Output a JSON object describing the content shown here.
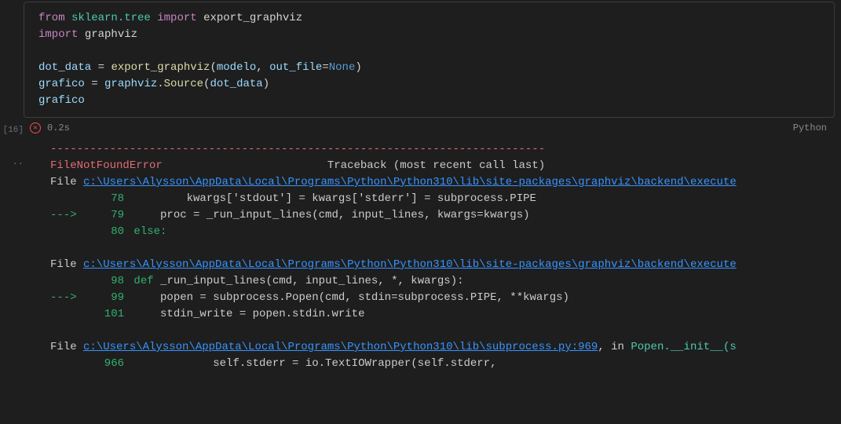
{
  "gutter": {
    "cell_label": "[16]",
    "dots": ".."
  },
  "code": {
    "l1_from": "from",
    "l1_mod": "sklearn.tree",
    "l1_import": "import",
    "l1_name": "export_graphviz",
    "l2_import": "import",
    "l2_name": "graphviz",
    "l4_var": "dot_data",
    "l4_eq": " = ",
    "l4_fn": "export_graphviz",
    "l4_open": "(",
    "l4_arg1": "modelo",
    "l4_comma": ", ",
    "l4_kwarg": "out_file",
    "l4_eqs": "=",
    "l4_none": "None",
    "l4_close": ")",
    "l5_var": "grafico",
    "l5_eq": " = ",
    "l5_mod": "graphviz",
    "l5_dot": ".",
    "l5_fn": "Source",
    "l5_open": "(",
    "l5_arg": "dot_data",
    "l5_close": ")",
    "l6": "grafico"
  },
  "status": {
    "time": "0.2s",
    "lang": "Python"
  },
  "traceback": {
    "dashes": "---------------------------------------------------------------------------",
    "error_name": "FileNotFoundError",
    "tb_label": "Traceback (most recent call last)",
    "file_word": "File ",
    "frames": [
      {
        "path": "c:\\Users\\Alysson\\AppData\\Local\\Programs\\Python\\Python310\\lib\\site-packages\\graphviz\\backend\\execute",
        "lines": [
          {
            "no": "78",
            "arrow": "     ",
            "code": "        kwargs['stdout'] = kwargs['stderr'] = subprocess.PIPE"
          },
          {
            "no": "79",
            "arrow": "---> ",
            "code": "    proc = _run_input_lines(cmd, input_lines, kwargs=kwargs)"
          },
          {
            "no": "80",
            "arrow": "     ",
            "code": "else:"
          }
        ]
      },
      {
        "path": "c:\\Users\\Alysson\\AppData\\Local\\Programs\\Python\\Python310\\lib\\site-packages\\graphviz\\backend\\execute",
        "lines": [
          {
            "no": "98",
            "arrow": "     ",
            "code": "def _run_input_lines(cmd, input_lines, *, kwargs):"
          },
          {
            "no": "99",
            "arrow": "---> ",
            "code": "    popen = subprocess.Popen(cmd, stdin=subprocess.PIPE, **kwargs)"
          },
          {
            "no": "101",
            "arrow": "     ",
            "code": "    stdin_write = popen.stdin.write"
          }
        ]
      },
      {
        "path": "c:\\Users\\Alysson\\AppData\\Local\\Programs\\Python\\Python310\\lib\\subprocess.py:969",
        "suffix_in": ", in ",
        "suffix_call": "Popen.__init__(s",
        "lines": [
          {
            "no": "966",
            "arrow": "     ",
            "code": "            self.stderr = io.TextIOWrapper(self.stderr,"
          }
        ]
      }
    ]
  }
}
